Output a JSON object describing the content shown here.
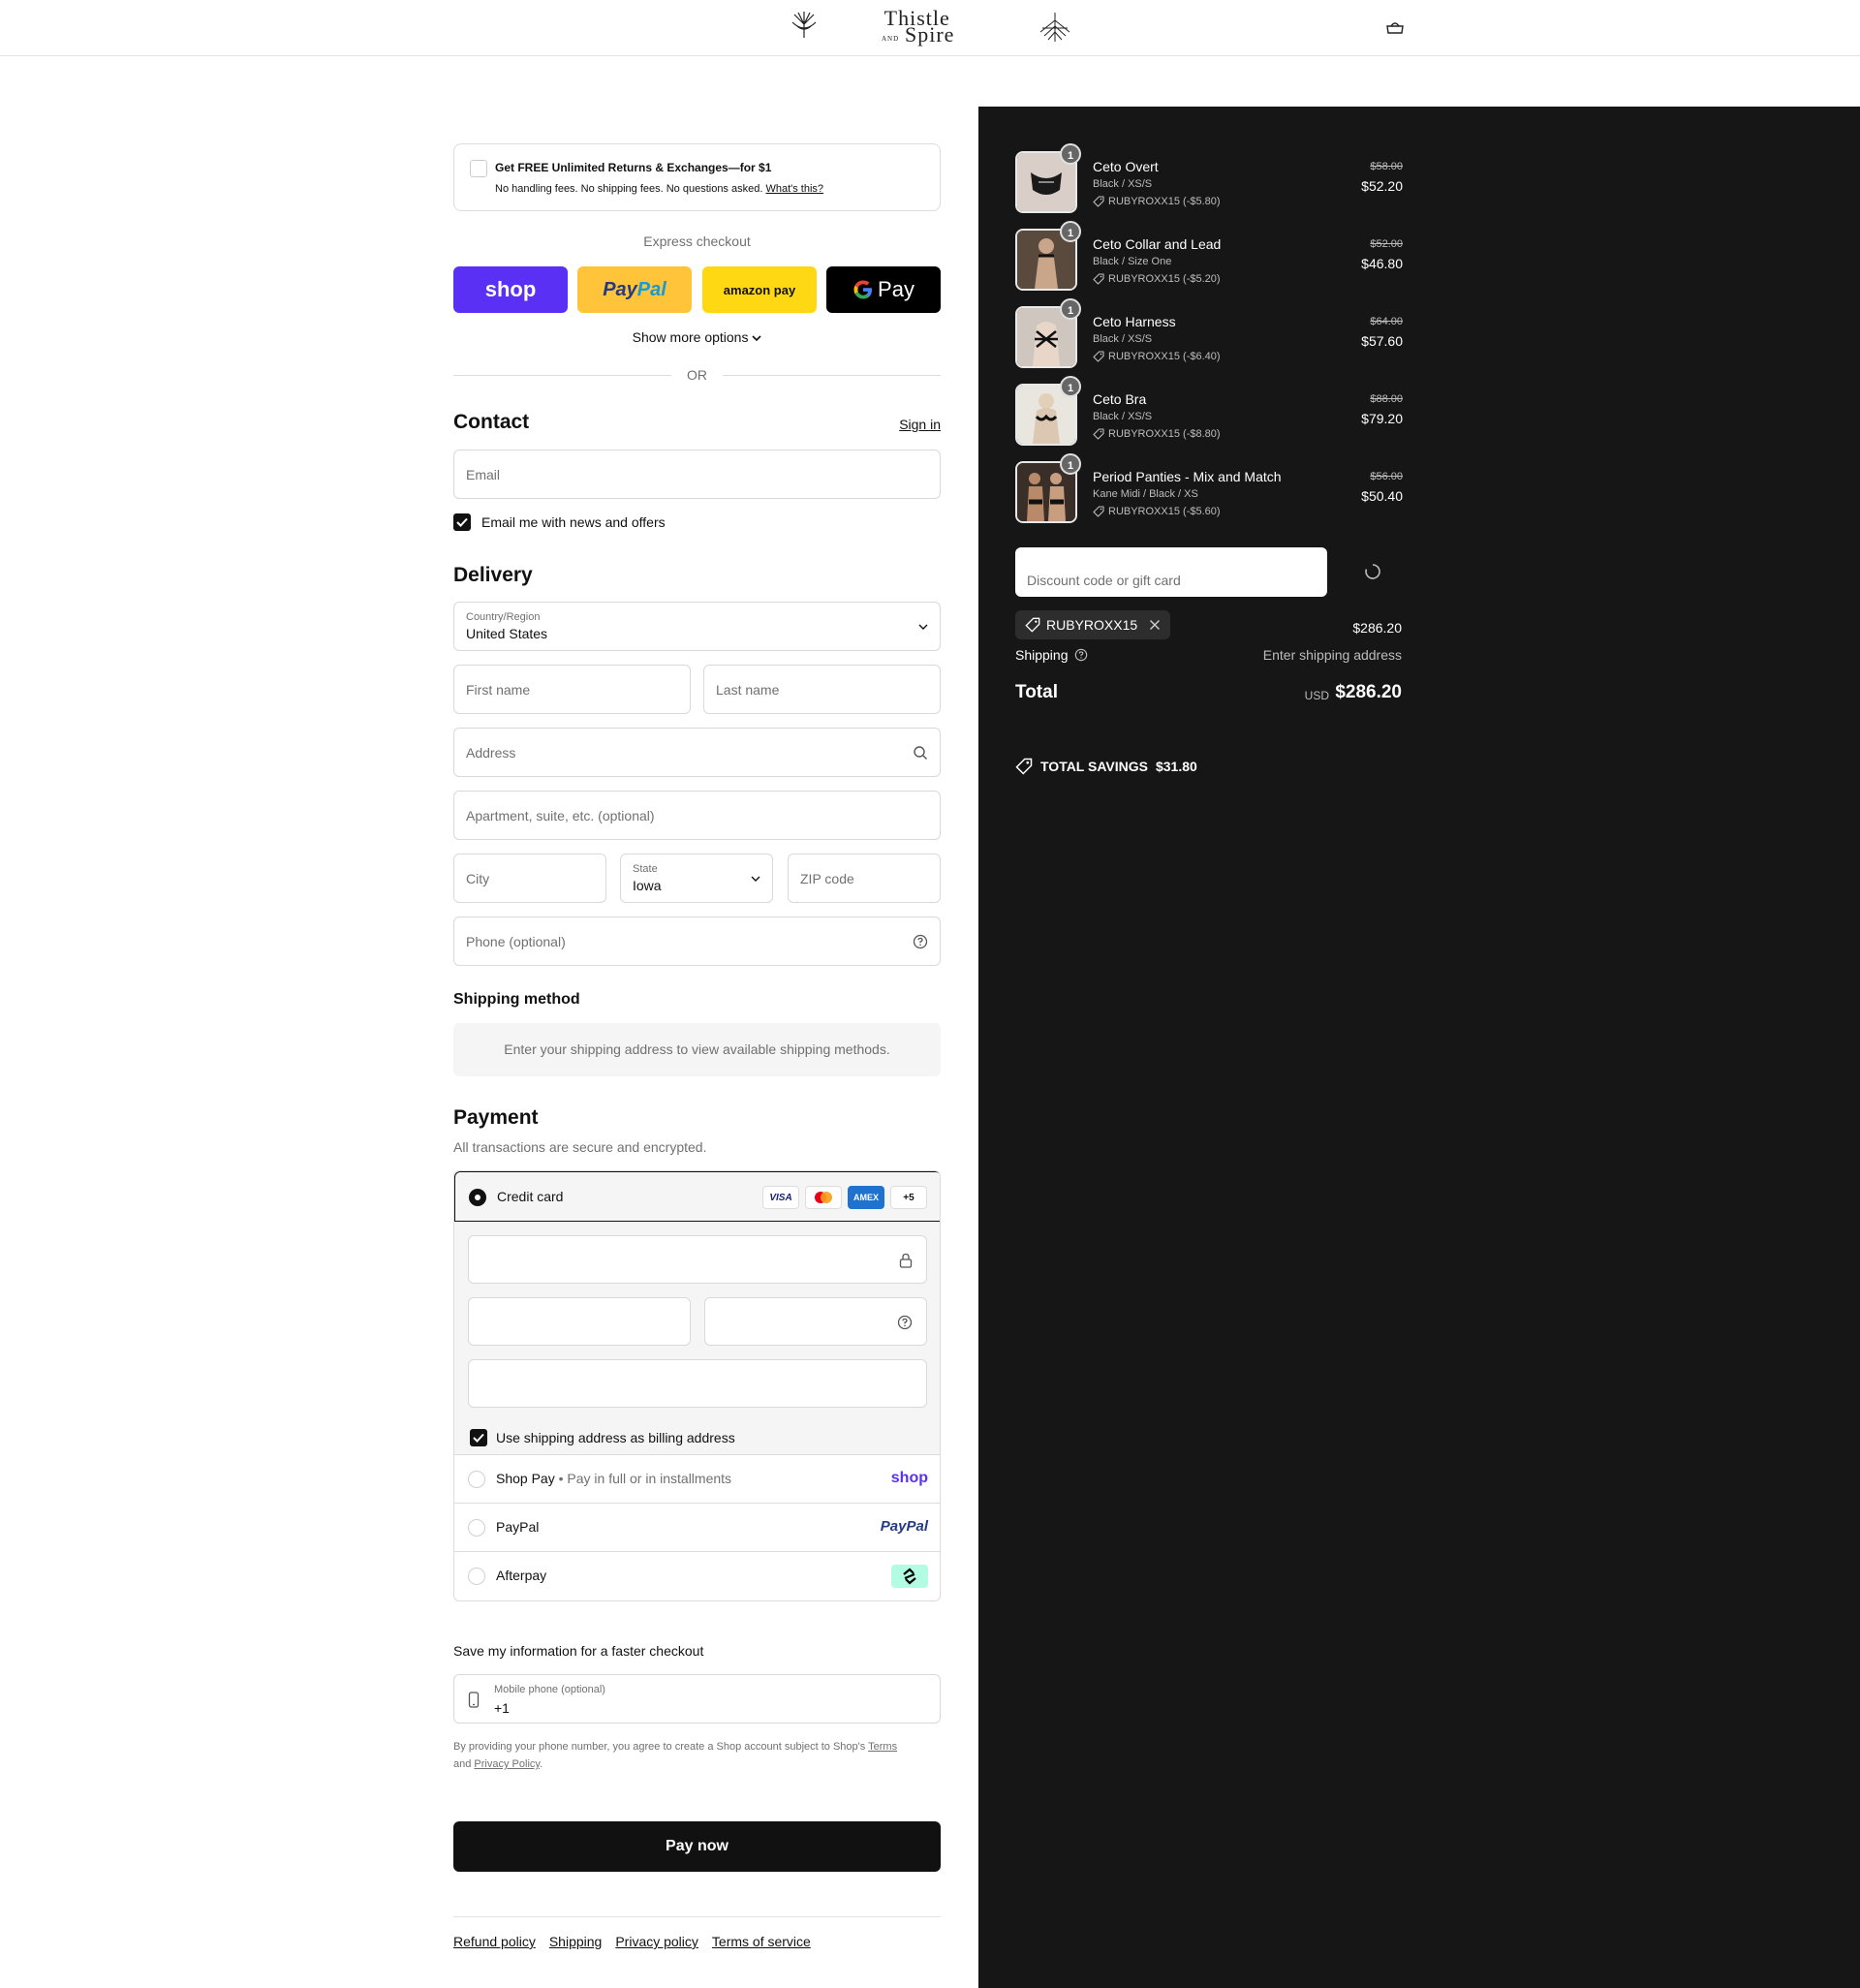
{
  "header": {
    "brand_line1": "Thistle",
    "brand_and": "AND",
    "brand_line2": "Spire",
    "cart_icon": "cart-icon"
  },
  "promo": {
    "title": "Get FREE Unlimited Returns & Exchanges—for $1",
    "subtitle": "No handling fees. No shipping fees. No questions asked.",
    "link": "What's this?"
  },
  "express": {
    "label": "Express checkout",
    "shop_label": "shop",
    "paypal_label_a": "Pay",
    "paypal_label_b": "Pal",
    "amazon_label": "amazon pay",
    "gpay_label": "Pay",
    "more_options": "Show more options",
    "or": "OR"
  },
  "contact": {
    "heading": "Contact",
    "sign_in": "Sign in",
    "email_placeholder": "Email",
    "news_label": "Email me with news and offers"
  },
  "delivery": {
    "heading": "Delivery",
    "country_label": "Country/Region",
    "country_value": "United States",
    "first_name_placeholder": "First name",
    "last_name_placeholder": "Last name",
    "address_placeholder": "Address",
    "apartment_placeholder": "Apartment, suite, etc. (optional)",
    "city_placeholder": "City",
    "state_label": "State",
    "state_value": "Iowa",
    "zip_placeholder": "ZIP code",
    "phone_placeholder": "Phone (optional)"
  },
  "shipping_method": {
    "heading": "Shipping method",
    "message": "Enter your shipping address to view available shipping methods."
  },
  "payment": {
    "heading": "Payment",
    "subtitle": "All transactions are secure and encrypted.",
    "credit_card_label": "Credit card",
    "card_logos": [
      "VISA",
      "",
      "AMEX",
      "+5"
    ],
    "billing_label": "Use shipping address as billing address",
    "shop_pay_label": "Shop Pay",
    "shop_pay_sub": "Pay in full or in installments",
    "shop_pay_logo": "shop",
    "paypal_label": "PayPal",
    "paypal_logo": "PayPal",
    "afterpay_label": "Afterpay"
  },
  "save_info": {
    "heading": "Save my information for a faster checkout",
    "mobile_label": "Mobile phone (optional)",
    "mobile_value": "+1",
    "legal_text_1": "By providing your phone number, you agree to create a Shop account subject to Shop's",
    "terms": "Terms",
    "legal_and": "and",
    "privacy": "Privacy Policy",
    "period": "."
  },
  "pay_now": "Pay now",
  "footer": {
    "links": [
      "Refund policy",
      "Shipping",
      "Privacy policy",
      "Terms of service"
    ]
  },
  "summary": {
    "items": [
      {
        "qty": "1",
        "name": "Ceto Overt",
        "variant": "Black / XS/S",
        "discount": "RUBYROXX15 (-$5.80)",
        "old_price": "$58.00",
        "price": "$52.20"
      },
      {
        "qty": "1",
        "name": "Ceto Collar and Lead",
        "variant": "Black / Size One",
        "discount": "RUBYROXX15 (-$5.20)",
        "old_price": "$52.00",
        "price": "$46.80"
      },
      {
        "qty": "1",
        "name": "Ceto Harness",
        "variant": "Black / XS/S",
        "discount": "RUBYROXX15 (-$6.40)",
        "old_price": "$64.00",
        "price": "$57.60"
      },
      {
        "qty": "1",
        "name": "Ceto Bra",
        "variant": "Black / XS/S",
        "discount": "RUBYROXX15 (-$8.80)",
        "old_price": "$88.00",
        "price": "$79.20"
      },
      {
        "qty": "1",
        "name": "Period Panties - Mix and Match",
        "variant": "Kane Midi / Black / XS",
        "discount": "RUBYROXX15 (-$5.60)",
        "old_price": "$56.00",
        "price": "$50.40"
      }
    ],
    "discount_placeholder": "Discount code or gift card",
    "applied_code": "RUBYROXX15",
    "subtotal": "$286.20",
    "shipping_label": "Shipping",
    "shipping_value": "Enter shipping address",
    "total_label": "Total",
    "currency": "USD",
    "total": "$286.20",
    "savings_label": "TOTAL SAVINGS",
    "savings_value": "$31.80"
  },
  "colors": {
    "shop_purple": "#5a31f4",
    "paypal_yellow": "#ffc439",
    "amazon_yellow": "#ffd814",
    "summary_bg": "#161616",
    "afterpay_mint": "#b2fce4"
  }
}
